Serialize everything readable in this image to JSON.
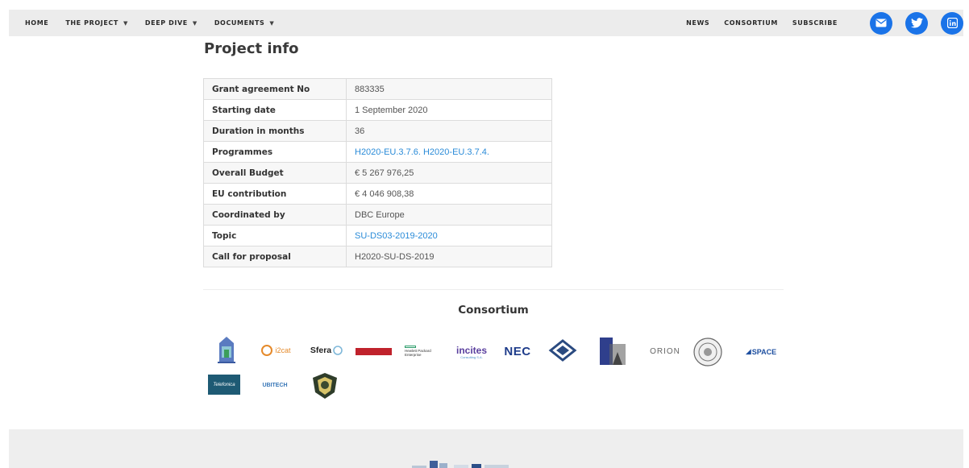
{
  "nav": {
    "left": [
      {
        "label": "HOME",
        "dropdown": false
      },
      {
        "label": "THE PROJECT",
        "dropdown": true
      },
      {
        "label": "DEEP DIVE",
        "dropdown": true
      },
      {
        "label": "DOCUMENTS",
        "dropdown": true
      }
    ],
    "right": [
      {
        "label": "NEWS"
      },
      {
        "label": "CONSORTIUM"
      },
      {
        "label": "SUBSCRIBE"
      }
    ],
    "caret": "▼",
    "social_icons": [
      "email-icon",
      "twitter-icon",
      "linkedin-icon"
    ],
    "social_color": "#1a73e8"
  },
  "page_title": "Project info",
  "project_info": [
    {
      "key": "Grant agreement No",
      "value": "883335",
      "link": false
    },
    {
      "key": "Starting date",
      "value": "1 September 2020",
      "link": false
    },
    {
      "key": "Duration in months",
      "value": "36",
      "link": false
    },
    {
      "key": "Programmes",
      "value": "H2020-EU.3.7.6. H2020-EU.3.7.4.",
      "link": true
    },
    {
      "key": "Overall Budget",
      "value": "€ 5 267 976,25",
      "link": false
    },
    {
      "key": "EU contribution",
      "value": "€ 4 046 908,38",
      "link": false
    },
    {
      "key": "Coordinated by",
      "value": "DBC Europe",
      "link": false
    },
    {
      "key": "Topic",
      "value": "SU-DS03-2019-2020",
      "link": true
    },
    {
      "key": "Call for proposal",
      "value": "H2020-SU-DS-2019",
      "link": false
    }
  ],
  "consortium": {
    "title": "Consortium",
    "logos": {
      "i2cat": "i2cat",
      "sfera": "Sfera",
      "hpe_line1": "Hewlett Packard",
      "hpe_line2": "Enterprise",
      "incites": "incites",
      "incites_sub": "Consulting S.A.",
      "nec": "NEC",
      "orion": "ORION",
      "space": "SPACE",
      "telefonica": "Telefonica",
      "ubitech": "UBITECH"
    }
  },
  "colors": {
    "link": "#2a8bd8",
    "nav_bg": "#ececec",
    "footer_bg": "#eeeeee"
  }
}
